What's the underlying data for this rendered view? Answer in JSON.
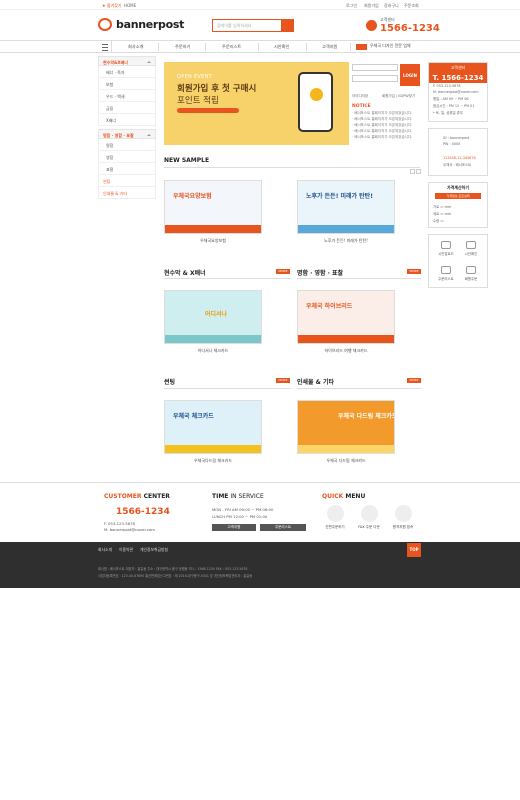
{
  "topbar": {
    "favorite": "★ 즐겨찾기",
    "home": "HOME",
    "links": [
      "로그인",
      "회원가입",
      "장바구니",
      "주문조회"
    ]
  },
  "header": {
    "logo": "bannerpost",
    "search_placeholder": "검색어를 입력하세요",
    "cc_label": "고객센터",
    "cc_number": "1566-1234"
  },
  "gnb": {
    "items": [
      "회사소개",
      "주문하기",
      "주문리스트",
      "시안확인",
      "고객지원"
    ],
    "promo": "우체국 디자인 전문 업체"
  },
  "lnb": {
    "groups": [
      {
        "title": "현수막&X배너",
        "items": [
          "배너 · 족자",
          "보험",
          "우드 · 액세",
          "금융",
          "X배너"
        ]
      },
      {
        "title": "명함 · 영함 · 표찰",
        "items": [
          "명함",
          "영함",
          "표찰"
        ]
      }
    ],
    "singles": [
      "썬팅",
      "인쇄물 & 기타"
    ]
  },
  "hero": {
    "open_event": "OPEN EVENT",
    "headline1": "회원가입 후 첫 구매시",
    "headline2": "포인트 적립",
    "period": "이벤트 기간 : 2016.10.00 ~ 2016.00.00"
  },
  "login": {
    "button": "LOGIN",
    "save_id": "아이디저장",
    "find": "회원가입 | ID/PW찾기"
  },
  "notice": {
    "title": "NOTICE",
    "rows": [
      "· 배너포스트 홈페이지가 오픈되었습니다.",
      "· 배너포스트 홈페이지가 오픈되었습니다.",
      "· 배너포스트 홈페이지가 오픈되었습니다.",
      "· 배너포스트 홈페이지가 오픈되었습니다.",
      "· 배너포스트 홈페이지가 오픈되었습니다."
    ]
  },
  "sections": {
    "new": "NEW SAMPLE",
    "banner": "현수막 & X배너",
    "card": "명함 · 영함 · 표찰",
    "sunting": "썬팅",
    "print": "인쇄물 & 기타",
    "more": "MORE"
  },
  "samples": [
    {
      "title": "우체국요양보험",
      "caption": "우체국요양보험"
    },
    {
      "title": "노후가 든든! 미래가 탄탄!",
      "caption": "노후가 든든! 미래가 탄탄!"
    },
    {
      "title": "어디서나",
      "caption": "어디서나 체크카드"
    },
    {
      "title": "우체국 하이브리드",
      "caption": "하이브리드 여행 체크카드"
    },
    {
      "title": "우체국 체크카드",
      "caption": "우체국다드림 체크카드"
    },
    {
      "title": "우체국 다드림 체크카드",
      "caption": "우체국 다드림 체크카드"
    }
  ],
  "right": {
    "cc_title": "고객센터",
    "cc_number": "T. 1566-1234",
    "fax": "F. 053-123-5678",
    "mail": "M. bannerpost@naver.com",
    "hours1": "평일 : AM 09 ~ PM 06",
    "hours2": "점심시간 : PM 12 ~ PM 01",
    "hours3": "* 토, 일, 공휴일 휴무",
    "id_label": "ID : bannerpost",
    "pw_label": "PW : 0000",
    "account": "123456-12-345678",
    "bank": "우체국 : 배너포스트",
    "calc_title": "가격계산하기",
    "calc_sub": "가격정보 모르실때",
    "calc_w": "가로",
    "calc_h": "세로",
    "calc_q": "수량",
    "calc_unit": "mm",
    "quick": [
      "시안업로드",
      "시안확인",
      "주문리스트",
      "회원주문"
    ]
  },
  "footer": {
    "cc_title_a": "CUSTOMER",
    "cc_title_b": " CENTER",
    "cc_number": "1566-1234",
    "fax": "F. 053-123-5678",
    "mail": "M. bannerpost@naver.com",
    "time_a": "TIME",
    "time_b": " IN SERVICE",
    "weekday": "MON - FRI   AM 09:00 ~ PM 06:00",
    "lunch": "LUNCH   PM 12:00 ~ PM 01:00",
    "btn1": "고객지원",
    "btn2": "주문리스트",
    "quick_a": "QUICK",
    "quick_b": " MENU",
    "quick": [
      "간편주문하기",
      "FAX 주문 다운",
      "원격지원 접속"
    ]
  },
  "bottom": {
    "links": [
      "회사소개",
      "이용약관",
      "개인정보취급방침"
    ],
    "line1": "회사명 : 배너포스트    대표자 : 홍길동    주소 : 대구광역시 중구 공평동    TEL : 1566-1234    FAX : 053-123-5678",
    "line2": "사업자등록번호 : 123-45-67890    통신판매업신고번호 : 제 2016-대구중구-0341 호    개인정보책임관리자 : 홍길동",
    "top": "TOP"
  }
}
